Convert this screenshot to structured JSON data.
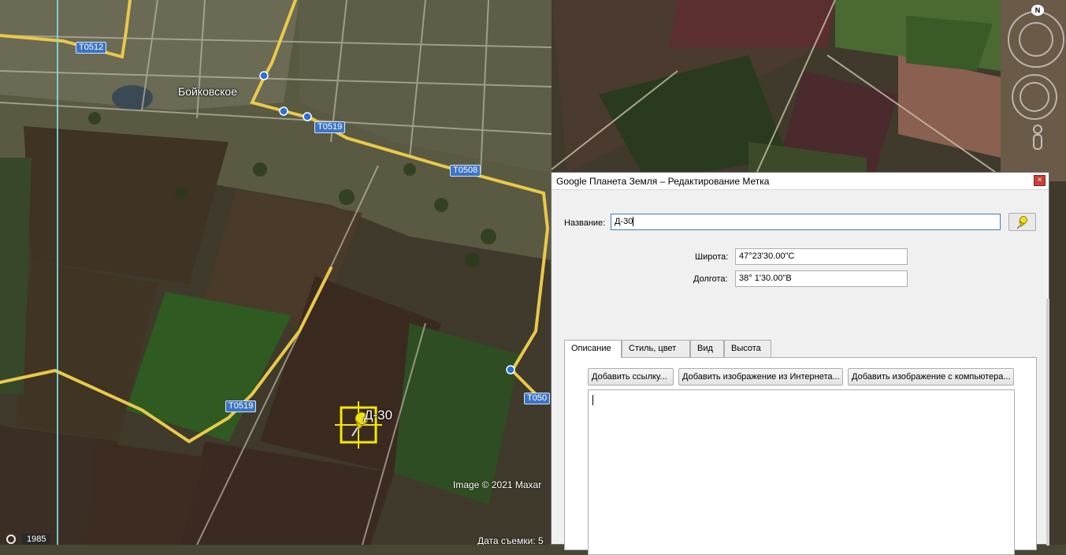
{
  "map": {
    "town_label": "Бойковское",
    "road_labels": [
      "T0512",
      "T0519",
      "T0508",
      "T0519",
      "T050"
    ],
    "placemark_label": "Д-30",
    "attribution": "Image © 2021 Maxar",
    "capture_date": "Дата съемки: 5",
    "history_year": "1985",
    "north_letter": "N",
    "colors": {
      "road": "#e8c94a",
      "placemark": "#f5e800",
      "road_label_bg": "#3d74c4"
    },
    "icons": [
      "north-compass-icon",
      "look-control-icon",
      "move-control-icon",
      "pegman-icon",
      "pushpin-icon",
      "history-clock-icon"
    ]
  },
  "dialog": {
    "title": "Google Планета Земля – Редактирование Метка",
    "close_label": "×",
    "name_label": "Название:",
    "name_value": "Д-30",
    "lat_label": "Широта:",
    "lat_value": "47°23'30.00\"С",
    "lon_label": "Долгота:",
    "lon_value": "38° 1'30.00\"В",
    "tabs": [
      "Описание",
      "Стиль, цвет",
      "Вид",
      "Высота"
    ],
    "active_tab": "Описание",
    "buttons": {
      "add_link": "Добавить ссылку...",
      "add_web_image": "Добавить изображение из Интернета...",
      "add_local_image": "Добавить изображение с компьютера..."
    },
    "description_value": ""
  }
}
